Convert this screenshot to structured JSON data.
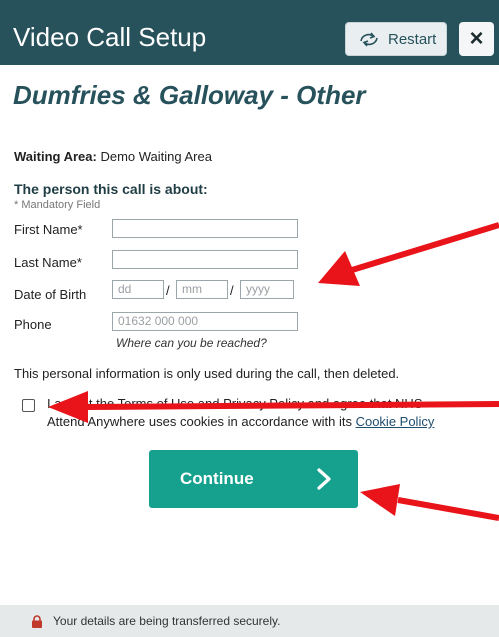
{
  "header": {
    "title": "Video Call Setup",
    "restart_label": "Restart",
    "restart_icon": "refresh-icon",
    "close_label": "×",
    "background_color": "#27525c"
  },
  "clinic_name": "Dumfries & Galloway - Other",
  "waiting_area": {
    "label": "Waiting Area:",
    "value": "Demo Waiting Area"
  },
  "form": {
    "section_title": "The person this call is about:",
    "mandatory_note": "* Mandatory Field",
    "first_name": {
      "label": "First Name*",
      "value": ""
    },
    "last_name": {
      "label": "Last Name*",
      "value": ""
    },
    "dob": {
      "label": "Date of Birth",
      "day_placeholder": "dd",
      "month_placeholder": "mm",
      "year_placeholder": "yyyy",
      "separator": "/"
    },
    "phone": {
      "label": "Phone",
      "placeholder": "01632 000 000",
      "hint": "Where can you be reached?"
    }
  },
  "info_text": "This personal information is only used during the call, then deleted.",
  "consent": {
    "checked": false,
    "line1": "I accept the Terms of Use and Privacy Policy and agree that NHS",
    "line2_prefix": "Attend Anywhere uses cookies in accordance with its",
    "cookie_link": "Cookie Policy"
  },
  "continue_button": {
    "label": "Continue",
    "icon": "chevron-right-icon",
    "color": "#16a18e"
  },
  "footer": {
    "icon": "lock-icon",
    "text": "Your details are being transferred securely."
  },
  "annotations": {
    "arrow_color": "#e8141a"
  }
}
